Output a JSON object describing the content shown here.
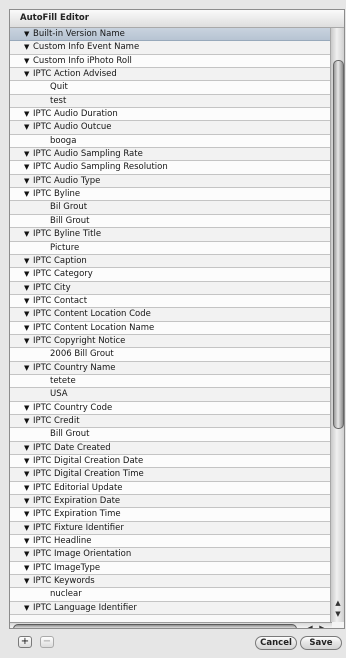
{
  "window": {
    "title": "AutoFill Editor"
  },
  "rows": [
    {
      "type": "header",
      "label": "Built-in Version Name",
      "selected": true
    },
    {
      "type": "header",
      "label": "Custom Info Event Name"
    },
    {
      "type": "header",
      "label": "Custom Info iPhoto Roll"
    },
    {
      "type": "header",
      "label": "IPTC Action Advised"
    },
    {
      "type": "child",
      "label": "Quit"
    },
    {
      "type": "child",
      "label": "test"
    },
    {
      "type": "header",
      "label": "IPTC Audio Duration"
    },
    {
      "type": "header",
      "label": "IPTC Audio Outcue"
    },
    {
      "type": "child",
      "label": "booga"
    },
    {
      "type": "header",
      "label": "IPTC Audio Sampling Rate"
    },
    {
      "type": "header",
      "label": "IPTC Audio Sampling Resolution"
    },
    {
      "type": "header",
      "label": "IPTC Audio Type"
    },
    {
      "type": "header",
      "label": "IPTC Byline"
    },
    {
      "type": "child",
      "label": "Bil Grout"
    },
    {
      "type": "child",
      "label": "Bill Grout"
    },
    {
      "type": "header",
      "label": "IPTC Byline Title"
    },
    {
      "type": "child",
      "label": "Picture"
    },
    {
      "type": "header",
      "label": "IPTC Caption"
    },
    {
      "type": "header",
      "label": "IPTC Category"
    },
    {
      "type": "header",
      "label": "IPTC City"
    },
    {
      "type": "header",
      "label": "IPTC Contact"
    },
    {
      "type": "header",
      "label": "IPTC Content Location Code"
    },
    {
      "type": "header",
      "label": "IPTC Content Location Name"
    },
    {
      "type": "header",
      "label": "IPTC Copyright Notice"
    },
    {
      "type": "child",
      "label": "2006 Bill Grout"
    },
    {
      "type": "header",
      "label": "IPTC Country Name"
    },
    {
      "type": "child",
      "label": "tetete"
    },
    {
      "type": "child",
      "label": "USA"
    },
    {
      "type": "header",
      "label": "IPTC Country Code"
    },
    {
      "type": "header",
      "label": "IPTC Credit"
    },
    {
      "type": "child",
      "label": "Bill Grout"
    },
    {
      "type": "header",
      "label": "IPTC Date Created"
    },
    {
      "type": "header",
      "label": "IPTC Digital Creation Date"
    },
    {
      "type": "header",
      "label": "IPTC Digital Creation Time"
    },
    {
      "type": "header",
      "label": "IPTC Editorial Update"
    },
    {
      "type": "header",
      "label": "IPTC Expiration Date"
    },
    {
      "type": "header",
      "label": "IPTC Expiration Time"
    },
    {
      "type": "header",
      "label": "IPTC Fixture Identifier"
    },
    {
      "type": "header",
      "label": "IPTC Headline"
    },
    {
      "type": "header",
      "label": "IPTC Image Orientation"
    },
    {
      "type": "header",
      "label": "IPTC ImageType"
    },
    {
      "type": "header",
      "label": "IPTC Keywords"
    },
    {
      "type": "child",
      "label": "nuclear"
    },
    {
      "type": "header",
      "label": "IPTC Language Identifier"
    }
  ],
  "buttons": {
    "add": "+",
    "remove": "−",
    "cancel": "Cancel",
    "save": "Save"
  },
  "icons": {
    "disclosure": "▼",
    "scroll_up": "▲",
    "scroll_down": "▼",
    "scroll_left": "◀",
    "scroll_right": "▶"
  }
}
